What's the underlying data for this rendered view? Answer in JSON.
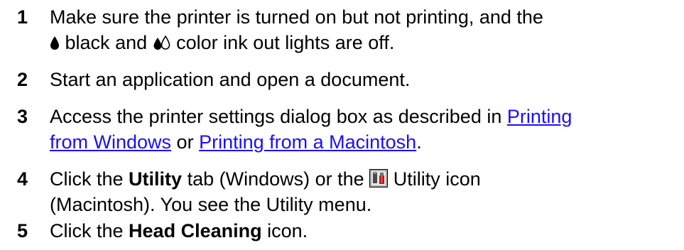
{
  "steps": [
    {
      "number": "1",
      "line1": "Make sure the printer is turned on but not printing, and the",
      "line2": {
        "black_word": "black",
        "and_word": "and",
        "rest": "color ink out lights are off."
      }
    },
    {
      "number": "2",
      "text": "Start an application and open a document."
    },
    {
      "number": "3",
      "line1_prefix": "Access the printer settings dialog box as described in",
      "link1_part1": "Printing",
      "link1_part2": "from Windows",
      "or_word": "or",
      "link2": "Printing from a Macintosh",
      "period": "."
    },
    {
      "number": "4",
      "prefix": "Click the",
      "bold": "Utility",
      "mid": "tab (Windows) or the",
      "icon_label": "Utility icon",
      "line2": "(Macintosh). You see the Utility menu."
    },
    {
      "number": "5",
      "prefix": "Click the",
      "bold": "Head Cleaning",
      "suffix": "icon."
    }
  ],
  "icons": {
    "black_ink": "black-ink-drop-icon",
    "color_ink": "color-ink-drops-icon",
    "utility": "utility-tools-icon"
  },
  "colors": {
    "link": "#1a0dff",
    "text": "#000000"
  }
}
